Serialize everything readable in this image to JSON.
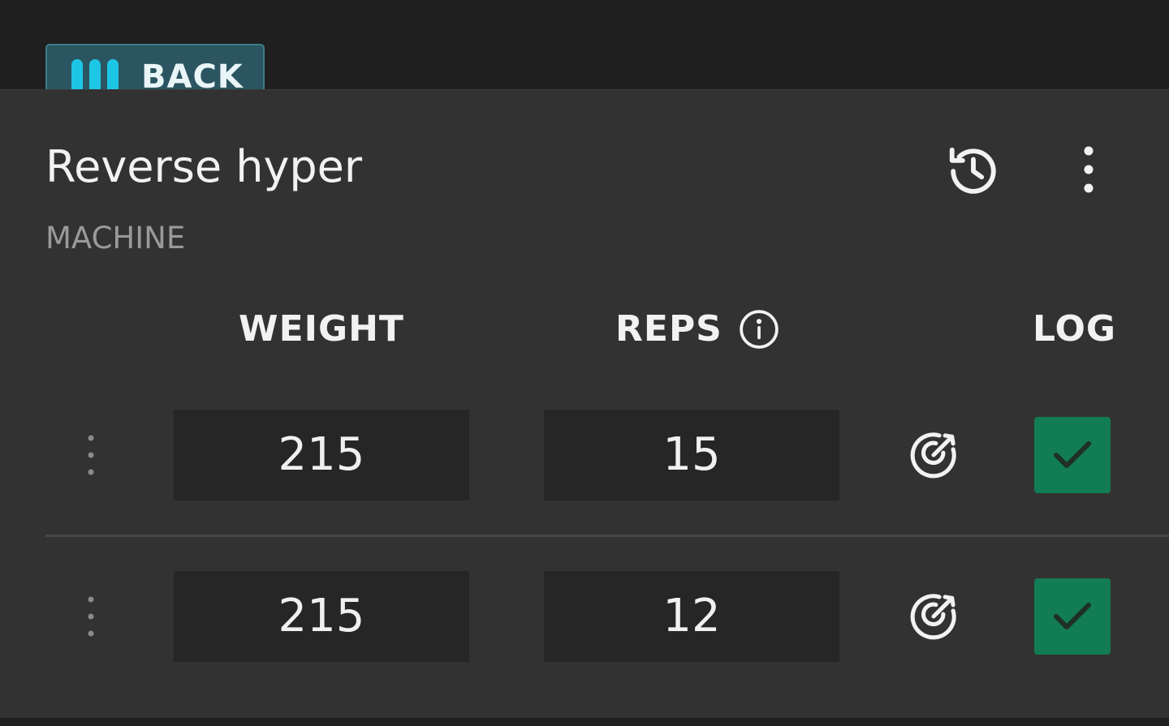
{
  "header": {
    "back_label": "BACK",
    "back_icon": "tally-bars-icon",
    "accent_color": "#1ec6e6"
  },
  "exercise": {
    "title": "Reverse hyper",
    "equipment": "MACHINE",
    "history_icon": "history-icon",
    "menu_icon": "more-vertical-icon"
  },
  "columns": {
    "weight": "WEIGHT",
    "reps": "REPS",
    "reps_info_icon": "info-icon",
    "log": "LOG"
  },
  "sets": [
    {
      "weight": "215",
      "reps": "15",
      "logged": true
    },
    {
      "weight": "215",
      "reps": "12",
      "logged": true
    }
  ],
  "colors": {
    "log_checked_bg": "#127c55",
    "input_bg": "#262626",
    "card_bg": "#323232"
  }
}
